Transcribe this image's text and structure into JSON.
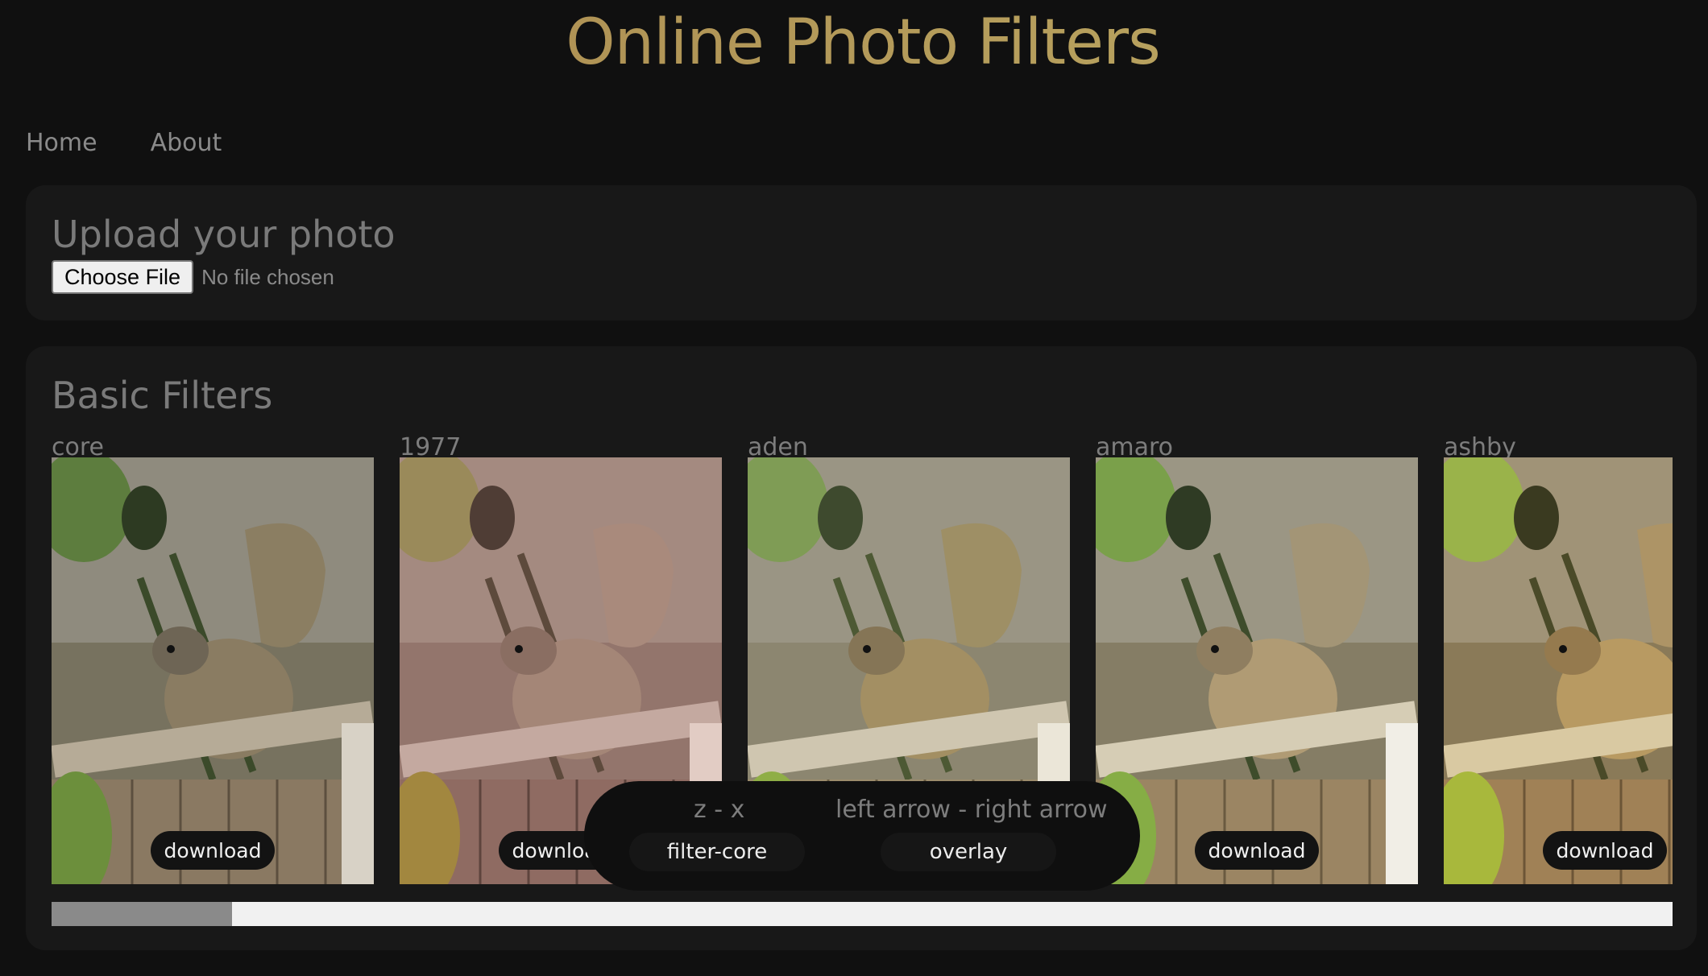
{
  "header": {
    "title": "Online Photo Filters"
  },
  "nav": {
    "home": "Home",
    "about": "About"
  },
  "upload": {
    "heading": "Upload your photo",
    "choose_button": "Choose File",
    "status": "No file chosen"
  },
  "filters": {
    "heading": "Basic Filters",
    "download_label": "download",
    "cards": [
      {
        "name": "core"
      },
      {
        "name": "1977"
      },
      {
        "name": "aden"
      },
      {
        "name": "amaro"
      },
      {
        "name": "ashby"
      }
    ],
    "scroll_position": 0.11
  },
  "overlay": {
    "key_left": "z - x",
    "key_right": "left arrow - right arrow",
    "filter_button": "filter-core",
    "overlay_button": "overlay"
  },
  "colors": {
    "background": "#101010",
    "panel": "#181818",
    "title_gradient_start": "#a8864d",
    "title_gradient_end": "#bfae66"
  }
}
